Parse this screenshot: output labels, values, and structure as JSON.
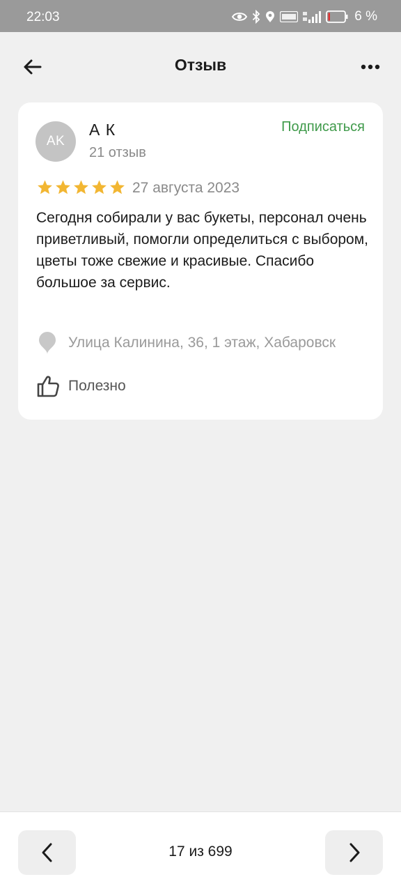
{
  "status_bar": {
    "time": "22:03",
    "battery_percent": "6 %",
    "icons": [
      "eye-icon",
      "bluetooth-icon",
      "location-icon",
      "volte-icon",
      "signal-icon",
      "battery-icon"
    ]
  },
  "header": {
    "title": "Отзыв",
    "back_icon": "arrow-left-icon",
    "more_icon": "more-dots-icon"
  },
  "review": {
    "author_initials": "AK",
    "author_name": "А К",
    "review_count": "21 отзыв",
    "subscribe_label": "Подписаться",
    "rating": 5,
    "date": "27 августа 2023",
    "text": "Сегодня собирали у вас букеты, персонал очень приветливый, помогли определиться с выбором, цветы тоже свежие и красивые. Спасибо большое за сервис.",
    "location": "Улица Калинина, 36, 1 этаж, Хабаровск",
    "helpful_label": "Полезно"
  },
  "pager": {
    "text": "17 из 699",
    "prev_icon": "chevron-left-icon",
    "next_icon": "chevron-right-icon"
  },
  "colors": {
    "accent_green": "#3f9a4a",
    "star_gold": "#f2b632",
    "status_bar": "#9a9a9a",
    "background": "#f0f0f0"
  }
}
